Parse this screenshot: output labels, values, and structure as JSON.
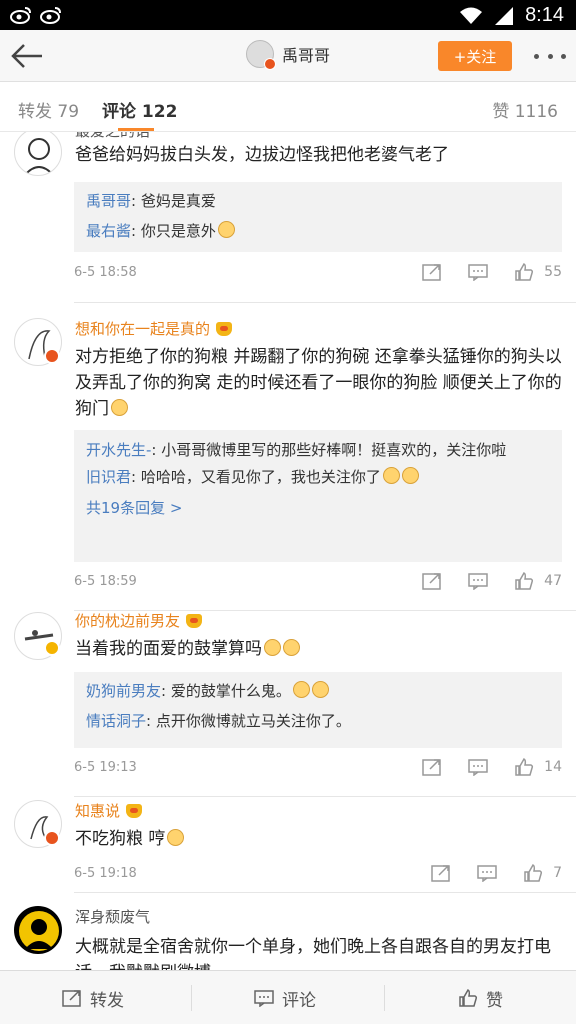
{
  "statusbar": {
    "time": "8:14"
  },
  "nav": {
    "title": "禹哥哥",
    "follow_label": "+关注"
  },
  "tabs": [
    {
      "label": "转发 79"
    },
    {
      "label": "评论 122"
    },
    {
      "label": "赞 1116"
    }
  ],
  "comments": [
    {
      "name": "最爱之的话",
      "text": "爸爸给妈妈拔白头发，边拔边怪我把他老婆气老了",
      "replies": [
        {
          "name": "禹哥哥",
          "text": ": 爸妈是真爱"
        },
        {
          "name": "最右酱",
          "text": ": 你只是意外"
        }
      ],
      "time": "6-5 18:58",
      "likes": "55"
    },
    {
      "name": "想和你在一起是真的",
      "text": "对方拒绝了你的狗粮 并踢翻了你的狗碗 还拿拳头猛锤你的狗头以及弄乱了你的狗窝 走的时候还看了一眼你的狗脸 顺便关上了你的狗门",
      "replies": [
        {
          "name": "开水先生-",
          "text": ": 小哥哥微博里写的那些好棒啊！挺喜欢的，关注你啦"
        },
        {
          "name": "旧识君",
          "text": ": 哈哈哈，又看见你了，我也关注你了"
        }
      ],
      "more": "共19条回复 >",
      "time": "6-5 18:59",
      "likes": "47"
    },
    {
      "name": "你的枕边前男友",
      "text": "当着我的面爱的鼓掌算吗",
      "replies": [
        {
          "name": "奶狗前男友",
          "text": ": 爱的鼓掌什么鬼。"
        },
        {
          "name": "情话洞子",
          "text": ": 点开你微博就立马关注你了。"
        }
      ],
      "time": "6-5 19:13",
      "likes": "14"
    },
    {
      "name": "知惠说",
      "text": "不吃狗粮 哼",
      "time": "6-5 19:18",
      "likes": "7"
    },
    {
      "name": "浑身颓废气",
      "text": "大概就是全宿舍就你一个单身，她们晚上各自跟各自的男友打电话，我默默刷微博"
    }
  ],
  "bottombar": {
    "repost": "转发",
    "comment": "评论",
    "like": "赞"
  }
}
